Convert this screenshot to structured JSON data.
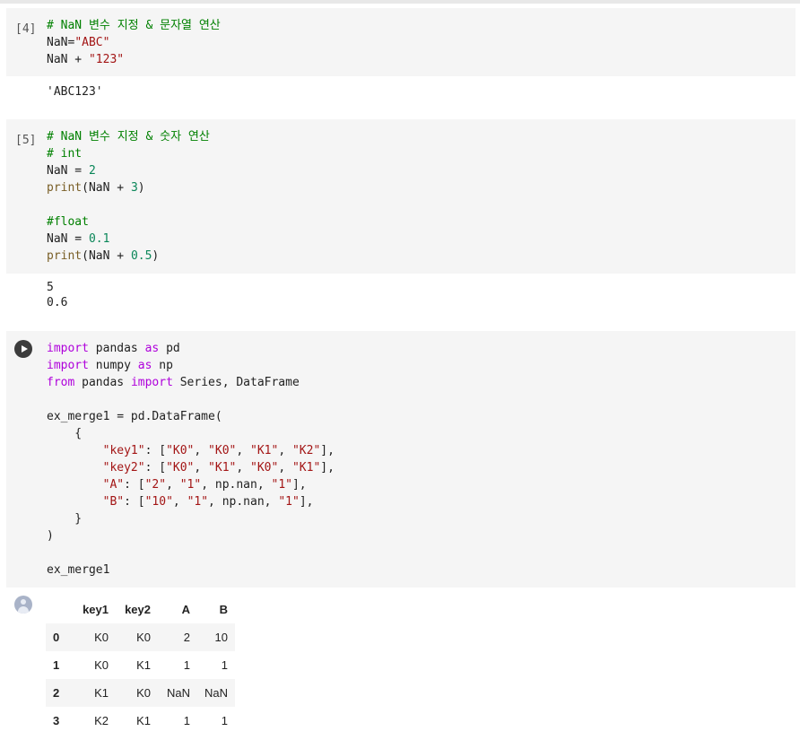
{
  "cells": [
    {
      "exec_label": "[4]",
      "code": [
        [
          {
            "t": "# NaN 변수 지정 & 문자열 연산",
            "c": "cm"
          }
        ],
        [
          {
            "t": "NaN="
          },
          {
            "t": "\"ABC\"",
            "c": "st"
          }
        ],
        [
          {
            "t": "NaN + "
          },
          {
            "t": "\"123\"",
            "c": "st"
          }
        ]
      ],
      "output": "'ABC123'"
    },
    {
      "exec_label": "[5]",
      "code": [
        [
          {
            "t": "# NaN 변수 지정 & 숫자 연산",
            "c": "cm"
          }
        ],
        [
          {
            "t": "# int",
            "c": "cm"
          }
        ],
        [
          {
            "t": "NaN = "
          },
          {
            "t": "2",
            "c": "nu"
          }
        ],
        [
          {
            "t": "print",
            "c": "fn"
          },
          {
            "t": "(NaN + "
          },
          {
            "t": "3",
            "c": "nu"
          },
          {
            "t": ")"
          }
        ],
        [],
        [
          {
            "t": "#float",
            "c": "cm"
          }
        ],
        [
          {
            "t": "NaN = "
          },
          {
            "t": "0.1",
            "c": "nu"
          }
        ],
        [
          {
            "t": "print",
            "c": "fn"
          },
          {
            "t": "(NaN + "
          },
          {
            "t": "0.5",
            "c": "nu"
          },
          {
            "t": ")"
          }
        ]
      ],
      "output": "5\n0.6"
    },
    {
      "exec_label": "",
      "code": [
        [
          {
            "t": "import",
            "c": "kw"
          },
          {
            "t": " pandas "
          },
          {
            "t": "as",
            "c": "kw"
          },
          {
            "t": " pd"
          }
        ],
        [
          {
            "t": "import",
            "c": "kw"
          },
          {
            "t": " numpy "
          },
          {
            "t": "as",
            "c": "kw"
          },
          {
            "t": " np"
          }
        ],
        [
          {
            "t": "from",
            "c": "kw"
          },
          {
            "t": " pandas "
          },
          {
            "t": "import",
            "c": "kw"
          },
          {
            "t": " Series, DataFrame"
          }
        ],
        [],
        [
          {
            "t": "ex_merge1 = pd.DataFrame("
          }
        ],
        [
          {
            "t": "    {"
          }
        ],
        [
          {
            "t": "        "
          },
          {
            "t": "\"key1\"",
            "c": "st"
          },
          {
            "t": ": ["
          },
          {
            "t": "\"K0\"",
            "c": "st"
          },
          {
            "t": ", "
          },
          {
            "t": "\"K0\"",
            "c": "st"
          },
          {
            "t": ", "
          },
          {
            "t": "\"K1\"",
            "c": "st"
          },
          {
            "t": ", "
          },
          {
            "t": "\"K2\"",
            "c": "st"
          },
          {
            "t": "],"
          }
        ],
        [
          {
            "t": "        "
          },
          {
            "t": "\"key2\"",
            "c": "st"
          },
          {
            "t": ": ["
          },
          {
            "t": "\"K0\"",
            "c": "st"
          },
          {
            "t": ", "
          },
          {
            "t": "\"K1\"",
            "c": "st"
          },
          {
            "t": ", "
          },
          {
            "t": "\"K0\"",
            "c": "st"
          },
          {
            "t": ", "
          },
          {
            "t": "\"K1\"",
            "c": "st"
          },
          {
            "t": "],"
          }
        ],
        [
          {
            "t": "        "
          },
          {
            "t": "\"A\"",
            "c": "st"
          },
          {
            "t": ": ["
          },
          {
            "t": "\"2\"",
            "c": "st"
          },
          {
            "t": ", "
          },
          {
            "t": "\"1\"",
            "c": "st"
          },
          {
            "t": ", np.nan, "
          },
          {
            "t": "\"1\"",
            "c": "st"
          },
          {
            "t": "],"
          }
        ],
        [
          {
            "t": "        "
          },
          {
            "t": "\"B\"",
            "c": "st"
          },
          {
            "t": ": ["
          },
          {
            "t": "\"10\"",
            "c": "st"
          },
          {
            "t": ", "
          },
          {
            "t": "\"1\"",
            "c": "st"
          },
          {
            "t": ", np.nan, "
          },
          {
            "t": "\"1\"",
            "c": "st"
          },
          {
            "t": "],"
          }
        ],
        [
          {
            "t": "    }"
          }
        ],
        [
          {
            "t": ")"
          }
        ],
        [],
        [
          {
            "t": "ex_merge1"
          }
        ]
      ]
    }
  ],
  "dataframe": {
    "columns": [
      "",
      "key1",
      "key2",
      "A",
      "B"
    ],
    "rows": [
      [
        "0",
        "K0",
        "K0",
        "2",
        "10"
      ],
      [
        "1",
        "K0",
        "K1",
        "1",
        "1"
      ],
      [
        "2",
        "K1",
        "K0",
        "NaN",
        "NaN"
      ],
      [
        "3",
        "K2",
        "K1",
        "1",
        "1"
      ]
    ]
  },
  "colors": {
    "comment": "#008000",
    "keyword": "#af00db",
    "function": "#795e26",
    "string": "#a31515",
    "number": "#098658",
    "cell_background": "#f5f5f5"
  },
  "icons": {
    "run_button": "play-circle-icon",
    "output_avatar": "user-avatar-icon"
  }
}
